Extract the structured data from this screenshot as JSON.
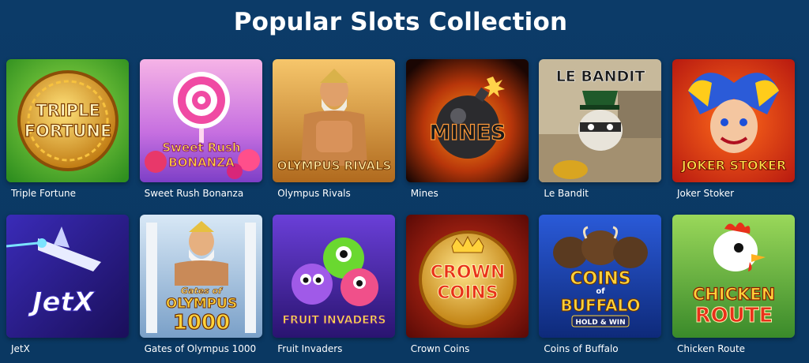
{
  "page": {
    "title": "Popular Slots Collection"
  },
  "games": [
    {
      "name": "Triple Fortune",
      "logo": [
        "TRIPLE",
        "FORTUNE"
      ]
    },
    {
      "name": "Sweet Rush Bonanza",
      "logo": [
        "Sweet Rush",
        "BONANZA"
      ]
    },
    {
      "name": "Olympus Rivals",
      "logo": [
        "OLYMPUS RIVALS"
      ]
    },
    {
      "name": "Mines",
      "logo": [
        "MINES"
      ]
    },
    {
      "name": "Le Bandit",
      "logo": [
        "LE BANDIT"
      ]
    },
    {
      "name": "Joker Stoker",
      "logo": [
        "JOKER STOKER"
      ]
    },
    {
      "name": "JetX",
      "logo": [
        "JetX"
      ]
    },
    {
      "name": "Gates of Olympus 1000",
      "logo": [
        "Gates of",
        "OLYMPUS",
        "1000"
      ]
    },
    {
      "name": "Fruit Invaders",
      "logo": [
        "FRUIT INVADERS"
      ]
    },
    {
      "name": "Crown Coins",
      "logo": [
        "CROWN",
        "COINS"
      ]
    },
    {
      "name": "Coins of Buffalo",
      "logo": [
        "COINS",
        "of",
        "BUFFALO",
        "HOLD & WIN"
      ]
    },
    {
      "name": "Chicken Route",
      "logo": [
        "CHICKEN",
        "ROUTE"
      ]
    }
  ]
}
